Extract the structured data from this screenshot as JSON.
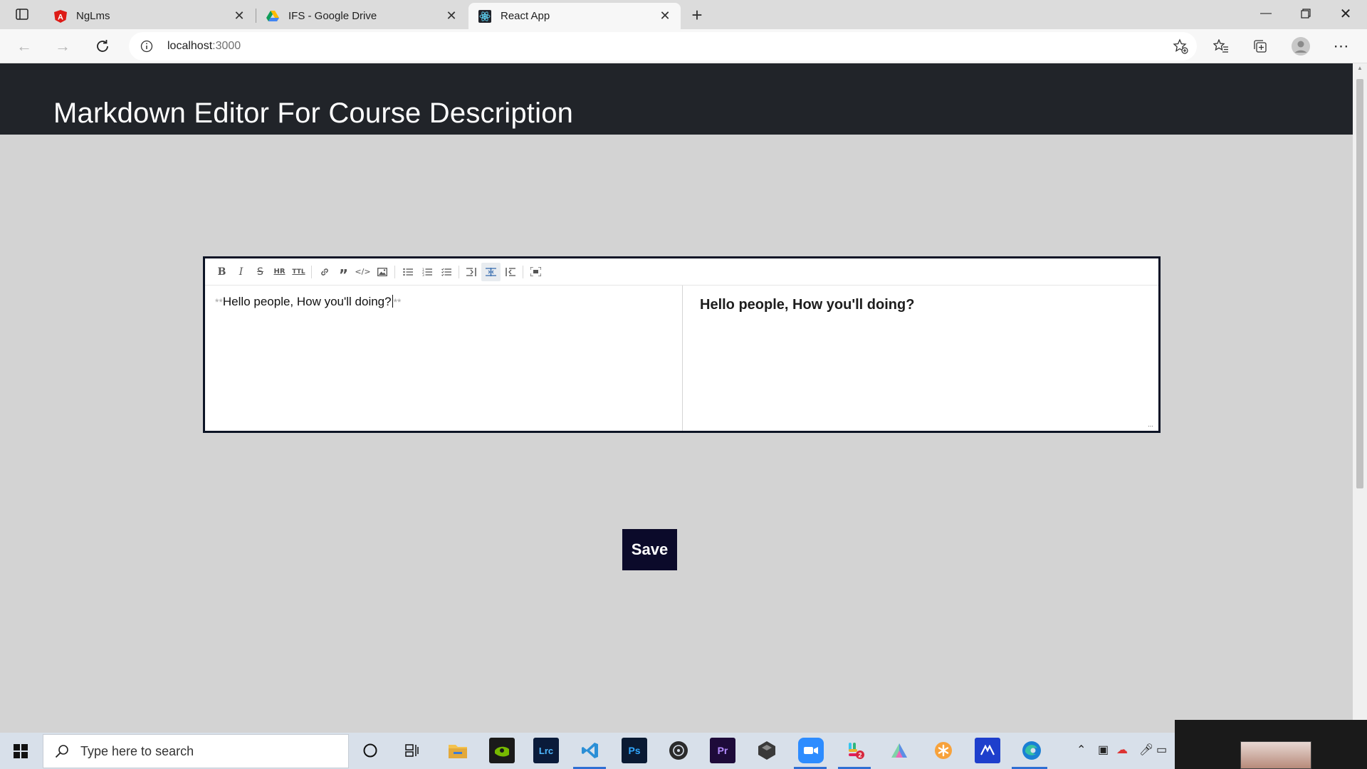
{
  "browser": {
    "tabs": [
      {
        "title": "NgLms",
        "icon": "angular-icon",
        "active": false
      },
      {
        "title": "IFS - Google Drive",
        "icon": "google-drive-icon",
        "active": false
      },
      {
        "title": "React App",
        "icon": "react-icon",
        "active": true
      }
    ],
    "address": {
      "host": "localhost",
      "port": ":3000"
    }
  },
  "page": {
    "title": "Markdown Editor For Course Description",
    "editor": {
      "toolbar": [
        "bold",
        "italic",
        "strikethrough",
        "hr",
        "title",
        "link",
        "quote",
        "code",
        "image",
        "unordered-list",
        "ordered-list",
        "checked-list",
        "edit-only",
        "live",
        "preview-only",
        "fullscreen"
      ],
      "markdown_prefix": "**",
      "markdown_text": "Hello people, How you'll doing?",
      "markdown_suffix": "**",
      "preview_text": "Hello people, How you'll doing?"
    },
    "save_label": "Save"
  },
  "taskbar": {
    "search_placeholder": "Type here to search",
    "apps": [
      "cortana-icon",
      "task-view-icon",
      "file-explorer-icon",
      "nvidia-icon",
      "lightroom-icon",
      "vscode-icon",
      "photoshop-icon",
      "github-icon",
      "premiere-icon",
      "unity-icon",
      "zoom-icon",
      "slack-icon",
      "prism-icon",
      "asterisk-icon",
      "linear-icon",
      "edge-icon"
    ],
    "app_labels": {
      "lightroom": "Lrc",
      "photoshop": "Ps",
      "premiere": "Pr",
      "slack_badge": "2"
    }
  },
  "colors": {
    "header_bg": "#212429",
    "page_bg": "#d3d3d3",
    "save_bg": "#0b0a2a",
    "editor_border": "#0d1526"
  }
}
